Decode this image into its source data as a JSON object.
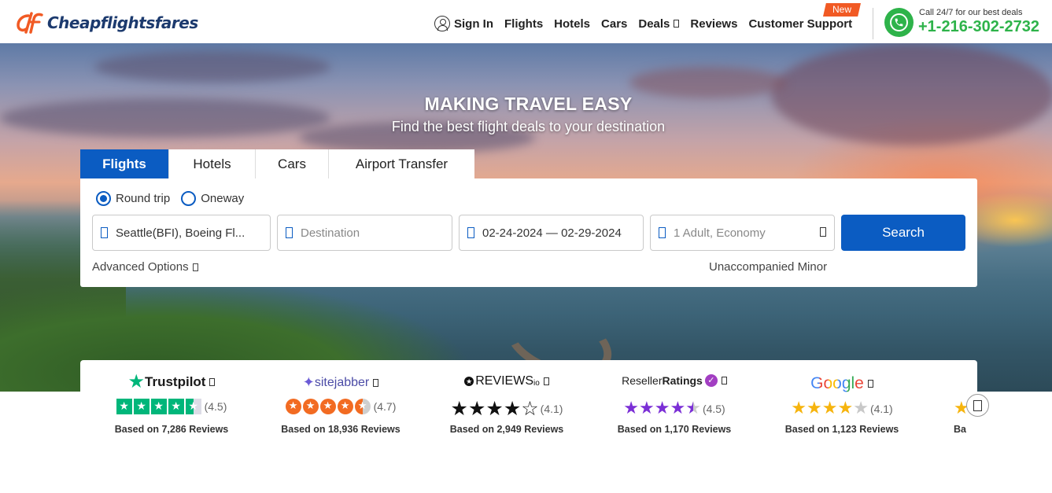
{
  "brand": {
    "name": "Cheapflightsfares",
    "accent": "#f15a24",
    "navy": "#1c3a6e"
  },
  "nav": {
    "sign_in": "Sign In",
    "items": [
      "Flights",
      "Hotels",
      "Cars",
      "Deals",
      "Reviews",
      "Customer Support"
    ],
    "new_badge": "New"
  },
  "call": {
    "caption": "Call 24/7 for our best deals",
    "number": "+1-216-302-2732",
    "color": "#2eb34a"
  },
  "hero": {
    "title": "MAKING TRAVEL EASY",
    "subtitle": "Find the best flight deals to your destination"
  },
  "tabs": [
    "Flights",
    "Hotels",
    "Cars",
    "Airport Transfer"
  ],
  "search": {
    "trip_types": [
      {
        "label": "Round trip",
        "selected": true
      },
      {
        "label": "Oneway",
        "selected": false
      }
    ],
    "origin": "Seattle(BFI), Boeing Fl...",
    "destination_placeholder": "Destination",
    "dates": "02-24-2024 — 02-29-2024",
    "travelers_placeholder": "1 Adult, Economy",
    "search_label": "Search",
    "advanced_options": "Advanced Options",
    "unaccompanied_minor": "Unaccompanied Minor",
    "primary_color": "#0b5cc2"
  },
  "reviews": [
    {
      "name": "Trustpilot",
      "score": "(4.5)",
      "rating": 4.5,
      "based_on": "Based on 7,286 Reviews"
    },
    {
      "name": "sitejabber",
      "score": "(4.7)",
      "rating": 4.7,
      "based_on": "Based on 18,936 Reviews"
    },
    {
      "name": "REVIEWS",
      "name_suffix": "io",
      "score": "(4.1)",
      "rating": 4.1,
      "based_on": "Based on 2,949 Reviews"
    },
    {
      "name": "Reseller",
      "name_suffix": "Ratings",
      "score": "(4.5)",
      "rating": 4.5,
      "based_on": "Based on 1,170 Reviews"
    },
    {
      "name": "Google",
      "score": "(4.1)",
      "rating": 4.1,
      "based_on": "Based on 1,123 Reviews"
    },
    {
      "based_on_partial": "Ba"
    }
  ]
}
